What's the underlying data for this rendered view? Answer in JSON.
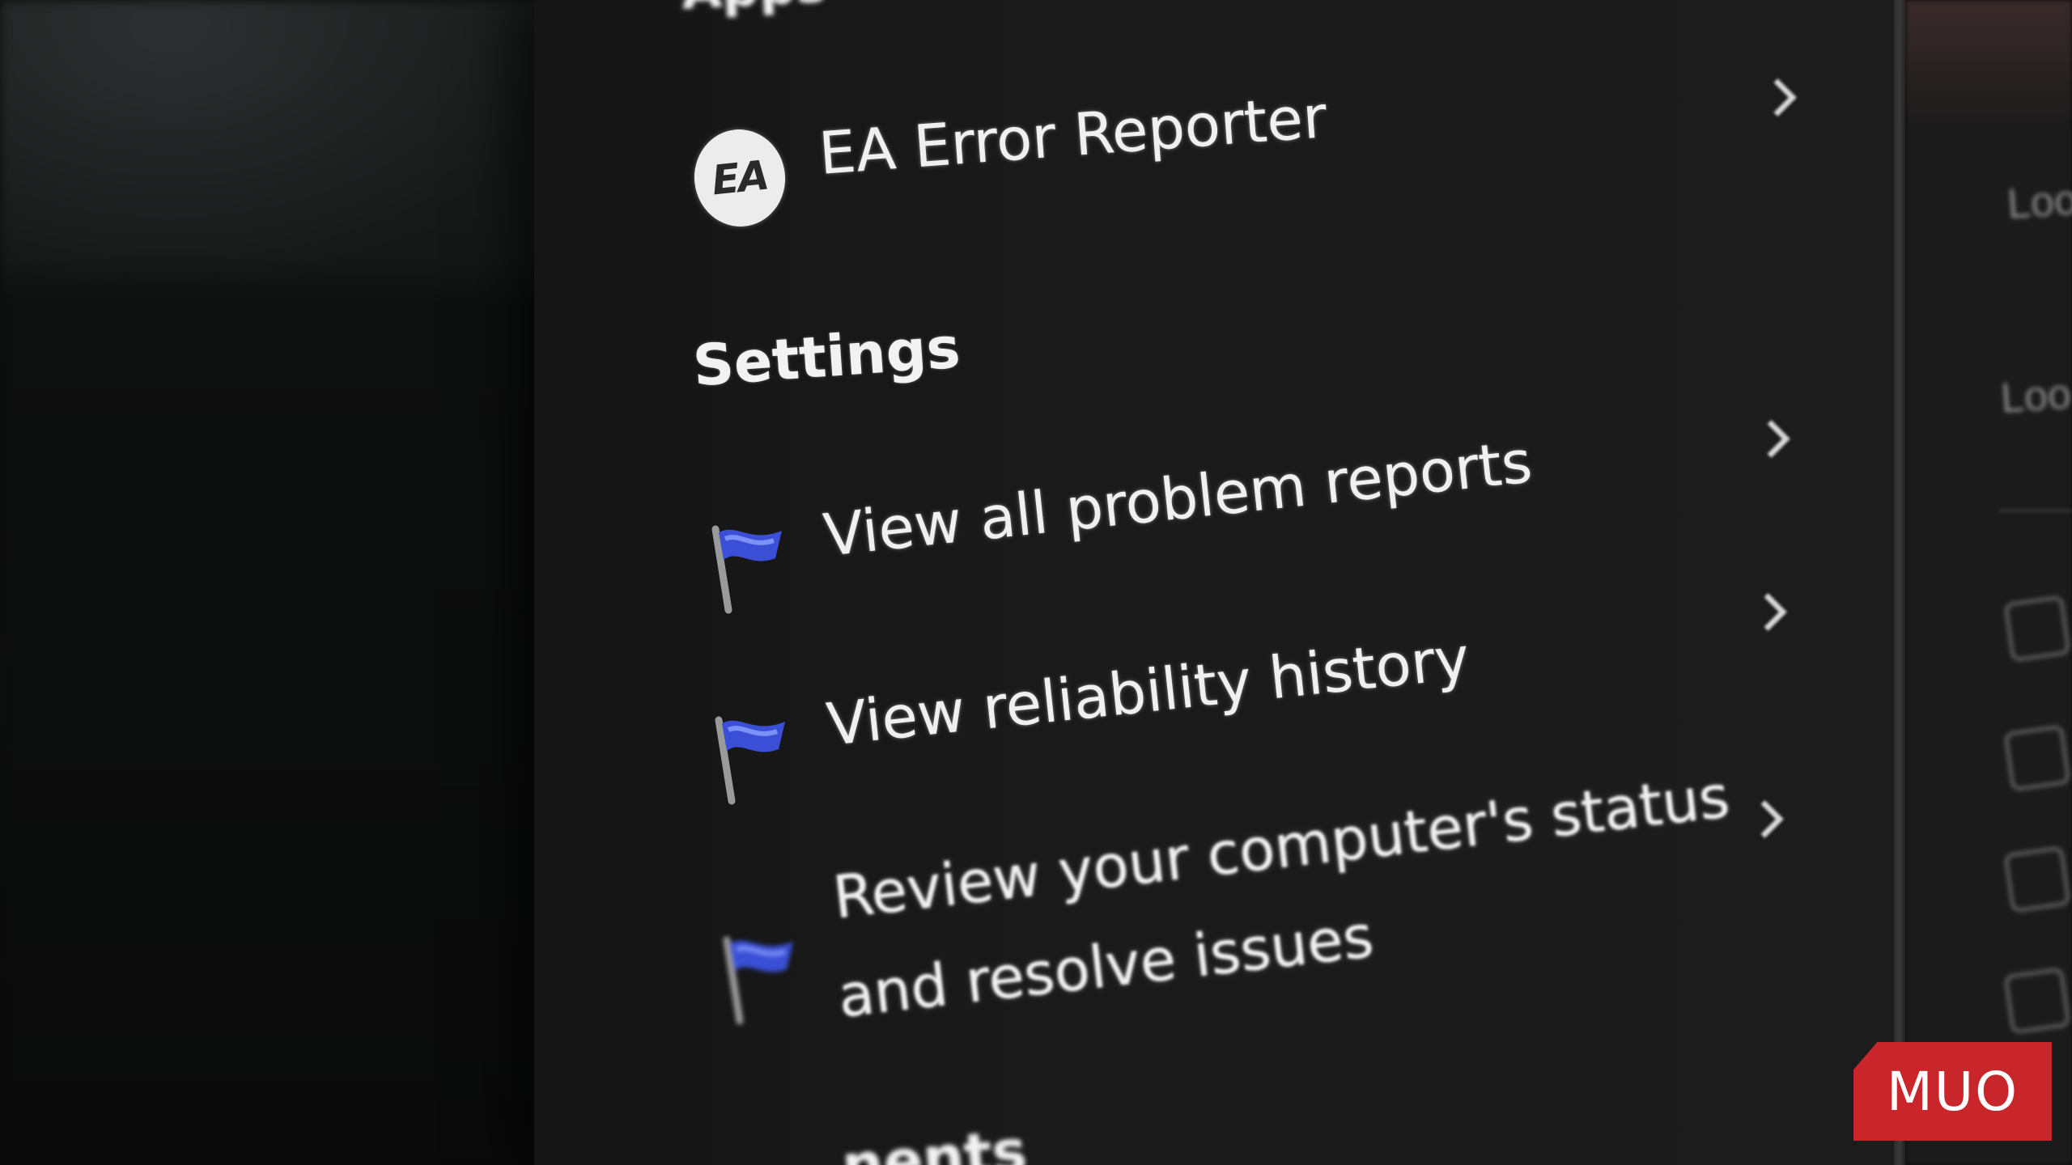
{
  "search_results": {
    "apps_heading": "Apps",
    "app_item": {
      "label": "EA Error Reporter",
      "icon": "ea-logo-icon",
      "icon_text": "EA"
    },
    "settings_heading": "Settings",
    "settings_items": [
      {
        "label": "View all problem reports",
        "icon": "blue-flag-icon"
      },
      {
        "label": "View reliability history",
        "icon": "blue-flag-icon"
      },
      {
        "label_line1": "Review your computer's status",
        "label_line2": "and resolve issues",
        "icon": "blue-flag-icon"
      }
    ],
    "next_heading_partial": "nents"
  },
  "right_pane": {
    "items": [
      "Loo",
      "Loo"
    ]
  },
  "watermark": {
    "text": "MUO",
    "color": "#c8262a"
  },
  "colors": {
    "panel_background": "#1a1a1a",
    "text": "#f0f0f0",
    "flag_blue": "#3a4fd6"
  }
}
